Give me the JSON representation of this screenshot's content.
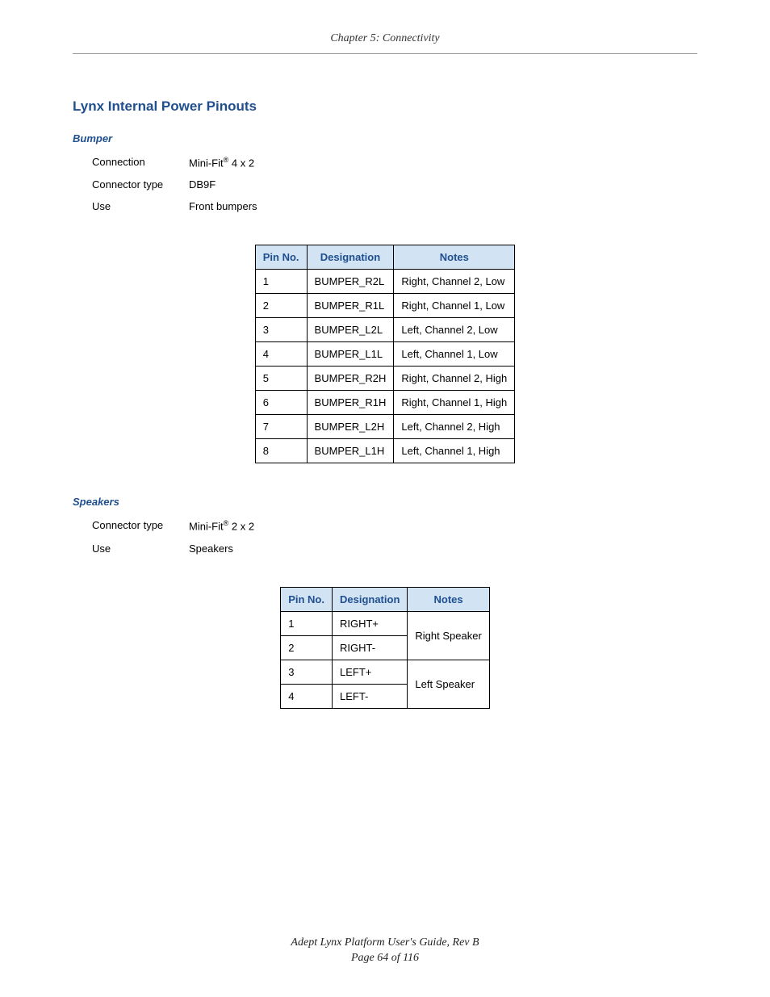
{
  "header": {
    "chapter": "Chapter 5: Connectivity"
  },
  "section": {
    "title": "Lynx Internal Power Pinouts"
  },
  "bumper": {
    "heading": "Bumper",
    "rows": {
      "connection_label": "Connection",
      "connection_value_prefix": "Mini-Fit",
      "connection_value_sup": "®",
      "connection_value_suffix": " 4 x 2",
      "connector_type_label": "Connector type",
      "connector_type_value": "DB9F",
      "use_label": "Use",
      "use_value": "Front bumpers"
    },
    "table": {
      "headers": {
        "pin": "Pin No.",
        "designation": "Designation",
        "notes": "Notes"
      },
      "data": [
        {
          "pin": "1",
          "designation": "BUMPER_R2L",
          "notes": "Right, Channel 2, Low"
        },
        {
          "pin": "2",
          "designation": "BUMPER_R1L",
          "notes": "Right, Channel 1, Low"
        },
        {
          "pin": "3",
          "designation": "BUMPER_L2L",
          "notes": "Left, Channel 2, Low"
        },
        {
          "pin": "4",
          "designation": "BUMPER_L1L",
          "notes": "Left, Channel 1, Low"
        },
        {
          "pin": "5",
          "designation": "BUMPER_R2H",
          "notes": "Right, Channel 2, High"
        },
        {
          "pin": "6",
          "designation": "BUMPER_R1H",
          "notes": "Right, Channel 1, High"
        },
        {
          "pin": "7",
          "designation": "BUMPER_L2H",
          "notes": "Left, Channel 2, High"
        },
        {
          "pin": "8",
          "designation": "BUMPER_L1H",
          "notes": "Left, Channel 1, High"
        }
      ]
    }
  },
  "speakers": {
    "heading": "Speakers",
    "rows": {
      "connector_type_label": "Connector type",
      "connector_type_value_prefix": "Mini-Fit",
      "connector_type_value_sup": "®",
      "connector_type_value_suffix": " 2 x 2",
      "use_label": "Use",
      "use_value": "Speakers"
    },
    "table": {
      "headers": {
        "pin": "Pin No.",
        "designation": "Designation",
        "notes": "Notes"
      },
      "data": [
        {
          "pin": "1",
          "designation": "RIGHT+"
        },
        {
          "pin": "2",
          "designation": "RIGHT-"
        },
        {
          "pin": "3",
          "designation": "LEFT+"
        },
        {
          "pin": "4",
          "designation": "LEFT-"
        }
      ],
      "notes_merged": {
        "right": "Right Speaker",
        "left": "Left Speaker"
      }
    }
  },
  "footer": {
    "line1": "Adept Lynx Platform User's Guide, Rev B",
    "line2": "Page 64 of 116"
  }
}
